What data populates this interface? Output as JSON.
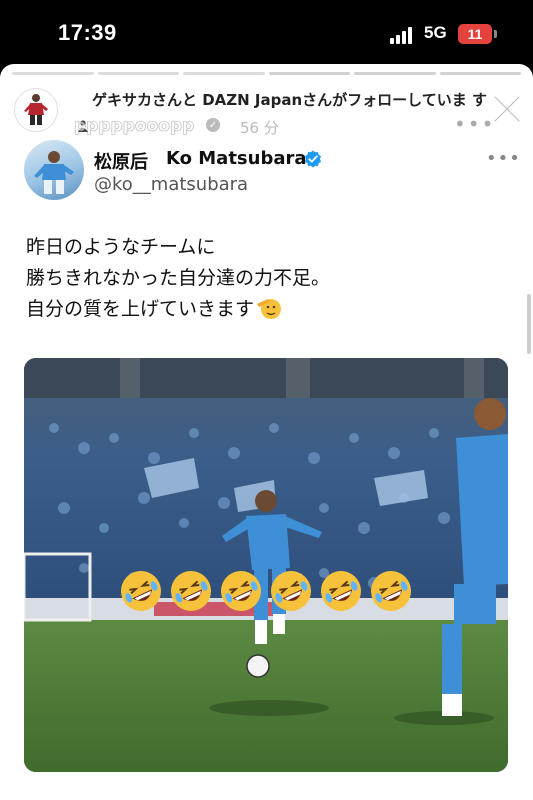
{
  "status_bar": {
    "time": "17:39",
    "network": "5G",
    "battery": "11"
  },
  "story": {
    "username": "pppppooopp",
    "time_ago": "56 分",
    "follow_notice": "ゲキサカさんと DAZN Japanさんがフォローしていま す"
  },
  "tweet": {
    "name_jp": "松原后",
    "name_en": "Ko Matsubara",
    "handle": "@ko__matsubara",
    "lines": [
      "昨日のようなチームに",
      "勝ちきれなかった自分達の力不足。",
      "自分の質を上げていきます"
    ],
    "emoji_icons": [
      "rofl-emoji",
      "rofl-emoji",
      "rofl-emoji",
      "rofl-emoji",
      "rofl-emoji",
      "rofl-emoji"
    ]
  },
  "colors": {
    "verified_blue": "#1d9bf0",
    "battery_red": "#e3433c",
    "jersey_blue": "#3f8fd6",
    "pitch_green": "#4f7d3c"
  }
}
